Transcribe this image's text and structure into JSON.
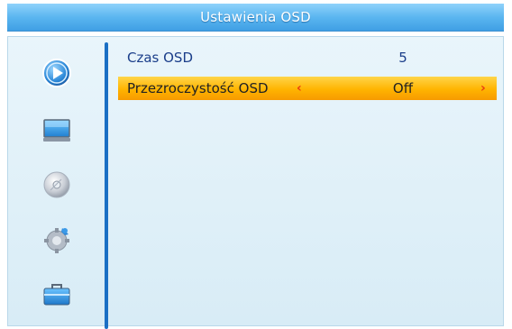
{
  "header": {
    "title": "Ustawienia OSD"
  },
  "sidebar": {
    "items": [
      {
        "icon": "play-icon"
      },
      {
        "icon": "monitor-icon"
      },
      {
        "icon": "disc-icon"
      },
      {
        "icon": "gear-icon"
      },
      {
        "icon": "toolbox-icon"
      }
    ]
  },
  "settings": {
    "rows": [
      {
        "label": "Czas OSD",
        "value": "5"
      },
      {
        "label": "Przezroczystość OSD",
        "value": "Off",
        "left_arrow": "‹",
        "right_arrow": "›"
      }
    ]
  },
  "colors": {
    "title_bar": "#5bb6f0",
    "panel_bg": "#e3f1f9",
    "selection": "#ffb400",
    "text": "#1b3e8a",
    "divider": "#1a6fc4",
    "arrow": "#e83d12"
  }
}
